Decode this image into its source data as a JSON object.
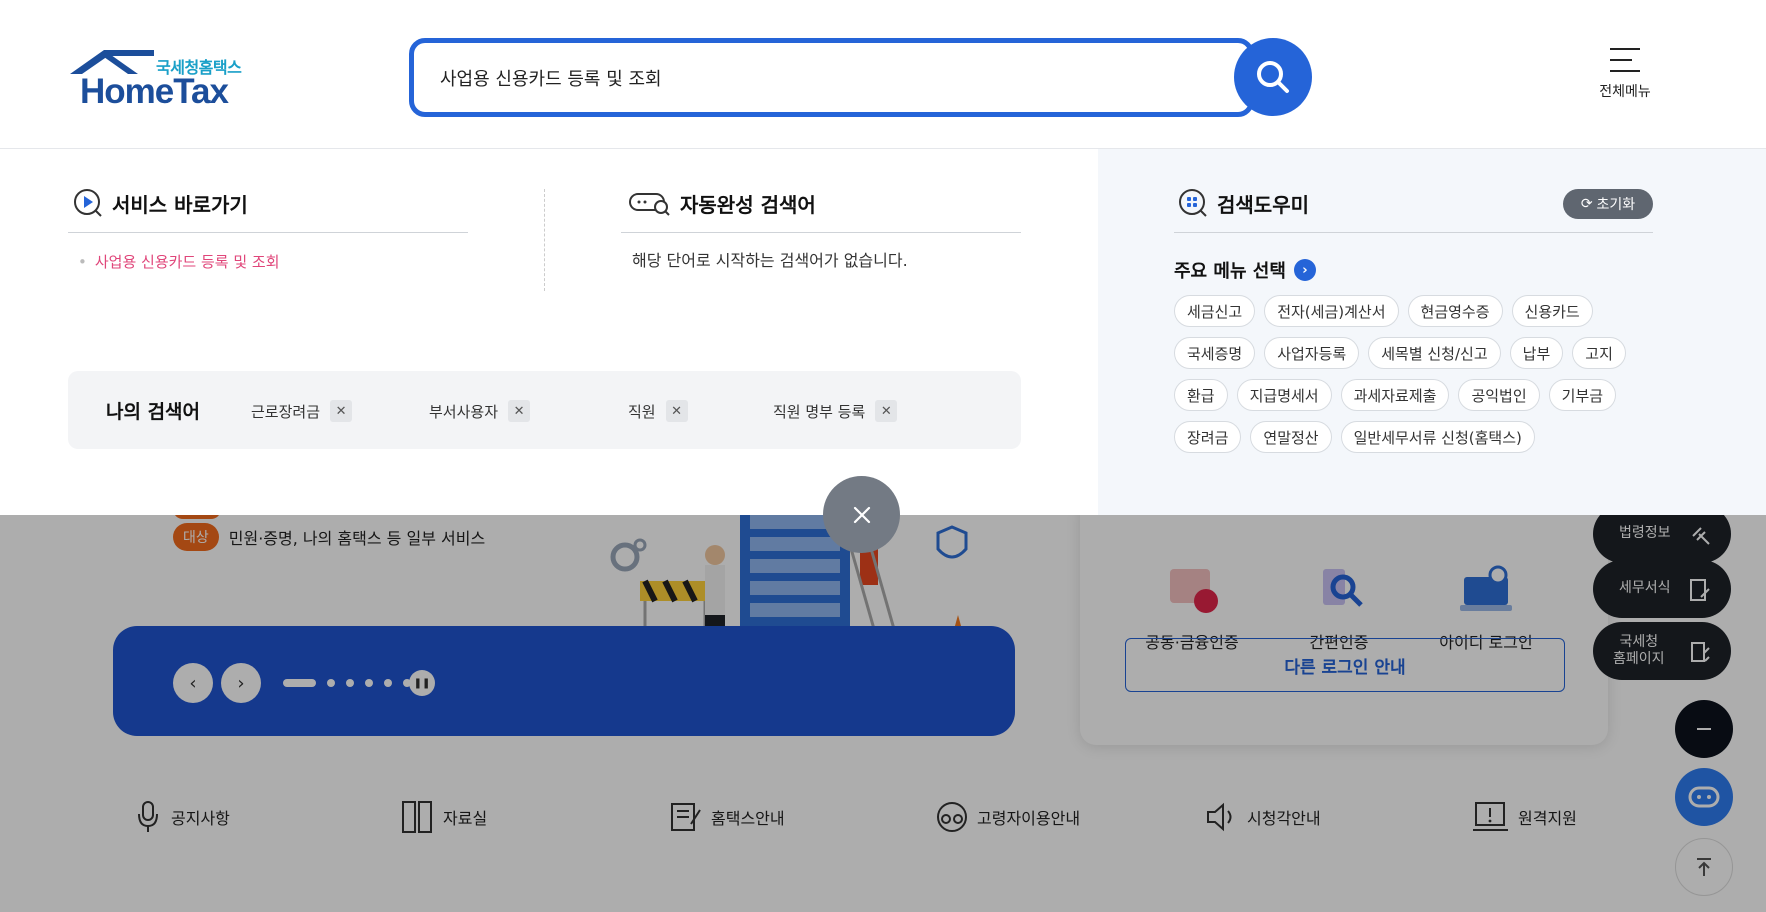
{
  "header": {
    "logo_sub": "국세청홈택스",
    "logo_main": "HomeTax",
    "search_value": "사업용 신용카드 등록 및 조회",
    "menu_label": "전체메뉴"
  },
  "panel": {
    "shortcut": {
      "title": "서비스 바로가기",
      "items": [
        "사업용 신용카드 등록 및 조회"
      ]
    },
    "autocomplete": {
      "title": "자동완성 검색어",
      "empty_message": "해당 단어로 시작하는 검색어가 없습니다."
    },
    "my_search": {
      "title": "나의 검색어",
      "keywords": [
        "근로장려금",
        "부서사용자",
        "직원",
        "직원 명부 등록"
      ]
    },
    "helper": {
      "title": "검색도우미",
      "reset_label": "초기화",
      "main_menu_title": "주요 메뉴 선택",
      "chip_rows": [
        [
          "세금신고",
          "전자(세금)계산서",
          "현금영수증",
          "신용카드"
        ],
        [
          "국세증명",
          "사업자등록",
          "세목별 신청/신고",
          "납부",
          "고지"
        ],
        [
          "환급",
          "지급명세서",
          "과세자료제출",
          "공익법인",
          "기부금"
        ],
        [
          "장려금",
          "연말정산",
          "일반세무서류 신청(홈택스)"
        ]
      ]
    }
  },
  "background": {
    "notice_tag": "대상",
    "notice_text": "민원·증명, 나의 홈택스 등 일부 서비스",
    "login": {
      "options": [
        "공동·금융인증",
        "간편인증",
        "아이디 로그인"
      ],
      "other_login": "다른 로그인 안내"
    },
    "side_buttons": [
      "법령정보",
      "세무서식",
      "국세청\n홈페이지"
    ],
    "quick_links": [
      "공지사항",
      "자료실",
      "홈택스안내",
      "고령자이용안내",
      "시청각안내",
      "원격지원"
    ]
  },
  "colors": {
    "primary": "#2564d8",
    "shortcut_link": "#e0467a",
    "logo_navy": "#1c4e9b",
    "logo_teal": "#1aa0c8",
    "notice_orange": "#f26b1d"
  }
}
